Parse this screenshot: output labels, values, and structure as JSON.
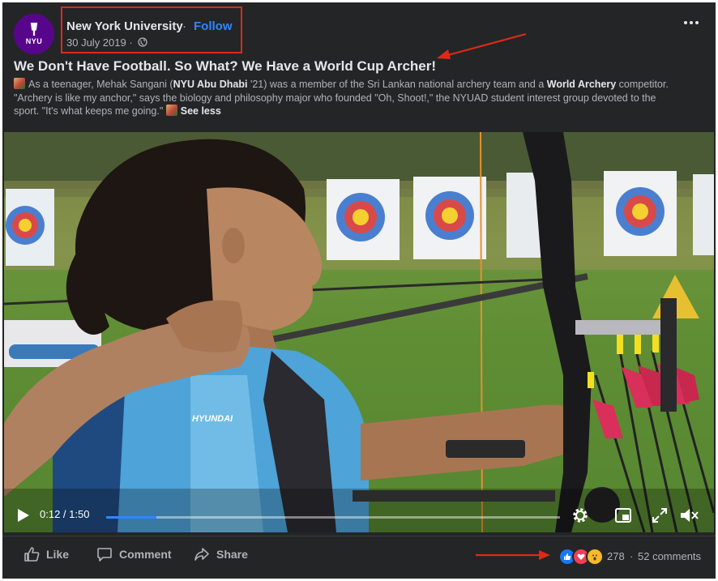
{
  "post": {
    "page_name": "New York University",
    "separator": "·",
    "follow_label": "Follow",
    "date": "30 July 2019 ·",
    "avatar_text": "NYU",
    "headline": "We Don't Have Football. So What? We Have a World Cup Archer!",
    "body": {
      "part1": "As a teenager, Mehak Sangani (",
      "bold1": "NYU Abu Dhabi",
      "part2": " '21) was a member of the Sri Lankan national archery team and a ",
      "bold2": "World Archery",
      "part3": " competitor. \"Archery is like my anchor,\" says the biology and philosophy major who founded \"Oh, Shoot!,\" the NYUAD student interest group devoted to the sport. \"It's what keeps me going.\" ",
      "see_less": "See less"
    }
  },
  "video": {
    "time": "0:12 / 1:50",
    "progress": 0.11,
    "shirt_brand": "HYUNDAI"
  },
  "actions": {
    "like": "Like",
    "comment": "Comment",
    "share": "Share"
  },
  "engagement": {
    "reaction_count": "278",
    "separator": "·",
    "comments": "52 comments"
  },
  "colors": {
    "highlight": "#e0281a",
    "accent": "#2d88ff",
    "nyu_purple": "#57068c"
  }
}
